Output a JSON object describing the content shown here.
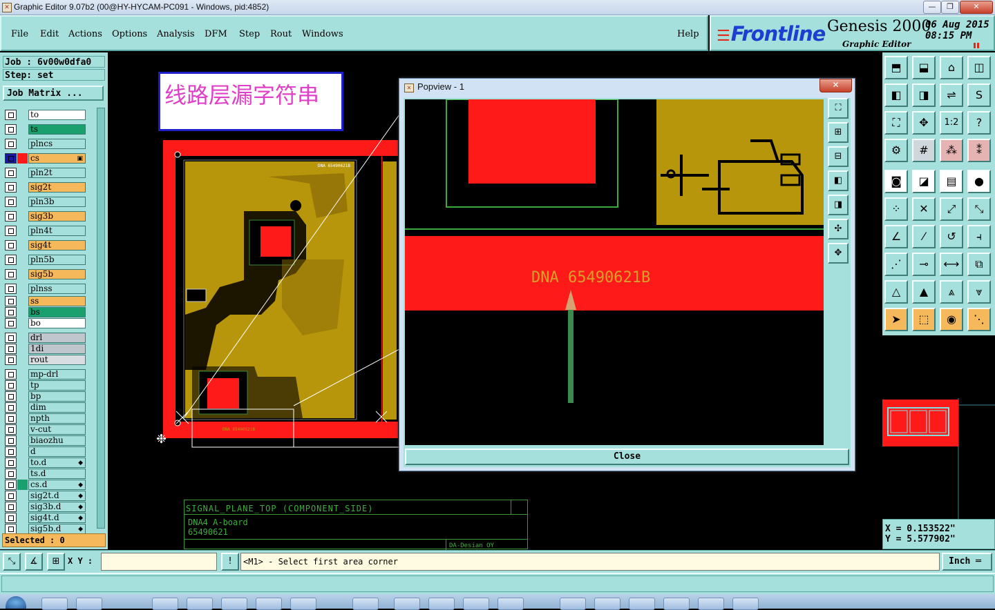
{
  "window": {
    "title": "Graphic Editor 9.07b2 (00@HY-HYCAM-PC091 - Windows, pid:4852)",
    "minimize": "—",
    "maximize": "❐",
    "close": "✕"
  },
  "menu": {
    "items": [
      "File",
      "Edit",
      "Actions",
      "Options",
      "Analysis",
      "DFM",
      "Step",
      "Rout",
      "Windows"
    ],
    "help": "Help"
  },
  "logo": {
    "brand": "Frontline",
    "product": "Genesis 2000",
    "subtitle": "Graphic Editor",
    "date": "06 Aug 2015",
    "time": "08:15 PM"
  },
  "job": {
    "job_label": "Job : 6v00w0dfa0",
    "step_label": "Step: set",
    "matrix_button": "Job Matrix ..."
  },
  "layers": [
    {
      "name": "to",
      "color": "#ffffff"
    },
    {
      "name": "ts",
      "color": "#1aa06e"
    },
    {
      "name": "plncs",
      "color": "#a6e0dc"
    },
    {
      "name": "cs",
      "color": "#f5b85a",
      "active": true
    },
    {
      "name": "pln2t",
      "color": "#a6e0dc"
    },
    {
      "name": "sig2t",
      "color": "#f5b85a"
    },
    {
      "name": "pln3b",
      "color": "#a6e0dc"
    },
    {
      "name": "sig3b",
      "color": "#f5b85a"
    },
    {
      "name": "pln4t",
      "color": "#a6e0dc"
    },
    {
      "name": "sig4t",
      "color": "#f5b85a"
    },
    {
      "name": "pln5b",
      "color": "#a6e0dc"
    },
    {
      "name": "sig5b",
      "color": "#f5b85a"
    },
    {
      "name": "plnss",
      "color": "#a6e0dc"
    },
    {
      "name": "ss",
      "color": "#f5b85a"
    },
    {
      "name": "bs",
      "color": "#1aa06e"
    },
    {
      "name": "bo",
      "color": "#ffffff"
    },
    {
      "name": "drl",
      "color": "#bfc6cc"
    },
    {
      "name": "1di",
      "color": "#bfc6cc"
    },
    {
      "name": "rout",
      "color": "#d8dde2"
    },
    {
      "name": "mp-drl",
      "color": "#a6e0dc"
    },
    {
      "name": "tp",
      "color": "#a6e0dc"
    },
    {
      "name": "bp",
      "color": "#a6e0dc"
    },
    {
      "name": "dim",
      "color": "#a6e0dc"
    },
    {
      "name": "npth",
      "color": "#a6e0dc"
    },
    {
      "name": "v-cut",
      "color": "#a6e0dc"
    },
    {
      "name": "biaozhu",
      "color": "#a6e0dc"
    },
    {
      "name": "d",
      "color": "#a6e0dc"
    },
    {
      "name": "to.d",
      "color": "#a6e0dc",
      "mark": true
    },
    {
      "name": "ts.d",
      "color": "#a6e0dc"
    },
    {
      "name": "cs.d",
      "color": "#a6e0dc",
      "mark": true,
      "swatch": "#1aa06e"
    },
    {
      "name": "sig2t.d",
      "color": "#a6e0dc",
      "mark": true
    },
    {
      "name": "sig3b.d",
      "color": "#a6e0dc",
      "mark": true
    },
    {
      "name": "sig4t.d",
      "color": "#a6e0dc",
      "mark": true
    },
    {
      "name": "sig5b.d",
      "color": "#a6e0dc",
      "mark": true
    }
  ],
  "selected": "Selected : 0",
  "annotation": "线路层漏字符串",
  "titleblock": {
    "line1": "SIGNAL_PLANE_TOP (COMPONENT_SIDE)",
    "line2": "DNA4  A-board",
    "line3": "65490621",
    "line4": "DA-Desian OY"
  },
  "popview": {
    "title": "Popview - 1",
    "close_label": "Close",
    "marking_text": "DNA 65490621B"
  },
  "coords": {
    "x": "X = 0.153522\"",
    "y": "Y = 5.577902\""
  },
  "command": {
    "xy_label": "X Y :",
    "prompt": "<M1> - Select first area corner",
    "unit": "Inch"
  },
  "colors": {
    "panel": "#a6e0dc",
    "copper": "#b8960c",
    "mask_red": "#ff1a1a",
    "highlight": "#f5b85a"
  }
}
